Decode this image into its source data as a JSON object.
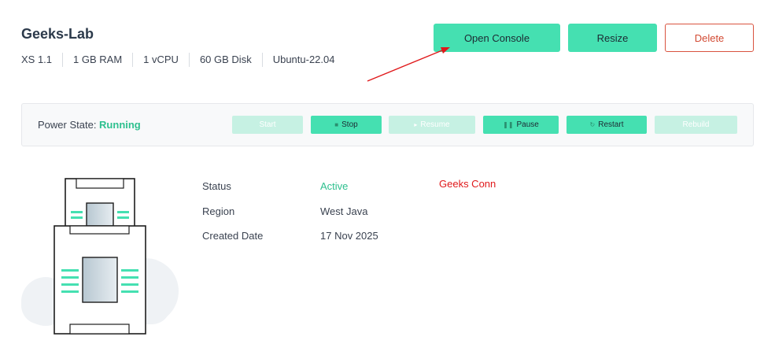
{
  "header": {
    "title": "Geeks-Lab",
    "specs": [
      "XS 1.1",
      "1 GB RAM",
      "1 vCPU",
      "60 GB Disk",
      "Ubuntu-22.04"
    ]
  },
  "actions": {
    "open_console": "Open Console",
    "resize": "Resize",
    "delete": "Delete"
  },
  "power": {
    "label": "Power State: ",
    "state": "Running",
    "buttons": [
      {
        "label": "Start",
        "icon": "play-icon",
        "enabled": false
      },
      {
        "label": "Stop",
        "icon": "stop-icon",
        "enabled": true
      },
      {
        "label": "Resume",
        "icon": "resume-icon",
        "enabled": false
      },
      {
        "label": "Pause",
        "icon": "pause-icon",
        "enabled": true
      },
      {
        "label": "Restart",
        "icon": "restart-icon",
        "enabled": true
      },
      {
        "label": "Rebuild",
        "icon": "rebuild-icon",
        "enabled": false
      }
    ]
  },
  "details": {
    "status_label": "Status",
    "status_value": "Active",
    "region_label": "Region",
    "region_value": "West Java",
    "created_label": "Created Date",
    "created_value": "17 Nov 2025"
  },
  "annotation": {
    "text": "Geeks Conn"
  },
  "colors": {
    "accent": "#45e0b1",
    "accent_disabled": "#c6f1e3",
    "running": "#2ec08f",
    "danger": "#d24a33",
    "annotation": "#e0191b"
  }
}
